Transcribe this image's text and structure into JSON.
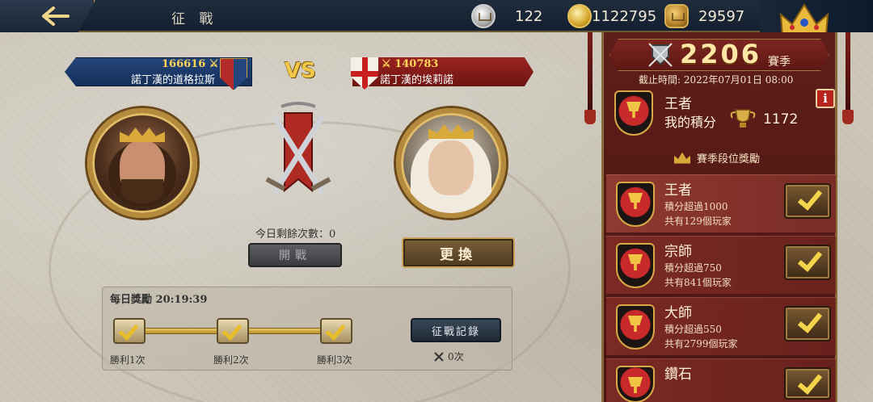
{
  "header": {
    "title": "征 戰",
    "resources": [
      {
        "icon": "silver-coin-icon",
        "value": "122"
      },
      {
        "icon": "gold-coin-icon",
        "value": "1122795"
      },
      {
        "icon": "crown-token-icon",
        "value": "29597"
      }
    ]
  },
  "versus": {
    "vs_label": "VS",
    "player": {
      "power": "166616",
      "name": "諾丁漢的道格拉斯"
    },
    "opponent": {
      "power": "140783",
      "name": "諾丁漢的埃莉諾"
    }
  },
  "battle": {
    "remaining_text": "今日剩餘次數：0",
    "battle_button": "開戰",
    "change_button": "更換"
  },
  "daily": {
    "title": "每日獎勵 20:19:39",
    "milestones": [
      {
        "label": "勝利1次"
      },
      {
        "label": "勝利2次"
      },
      {
        "label": "勝利3次"
      }
    ],
    "record_button": "征戰記錄",
    "record_count": "0次"
  },
  "season": {
    "number": "2206",
    "word": "賽季",
    "deadline": "截止時間: 2022年07月01日 08:00",
    "my_rank": "王者",
    "my_score_label": "我的積分",
    "my_score": "1172",
    "info": "i",
    "rewards_title": "賽季段位獎勵",
    "tiers": [
      {
        "name": "王者",
        "req": "積分超過1000",
        "players": "共有129個玩家"
      },
      {
        "name": "宗師",
        "req": "積分超過750",
        "players": "共有841個玩家"
      },
      {
        "name": "大師",
        "req": "積分超過550",
        "players": "共有2799個玩家"
      },
      {
        "name": "鑽石",
        "req": "",
        "players": ""
      }
    ]
  },
  "colors": {
    "topbar": "#1a2636",
    "player_banner": "#1f3f72",
    "opponent_banner": "#8e1f1c",
    "season_panel": "#561b17",
    "gold_text": "#ffd457"
  }
}
